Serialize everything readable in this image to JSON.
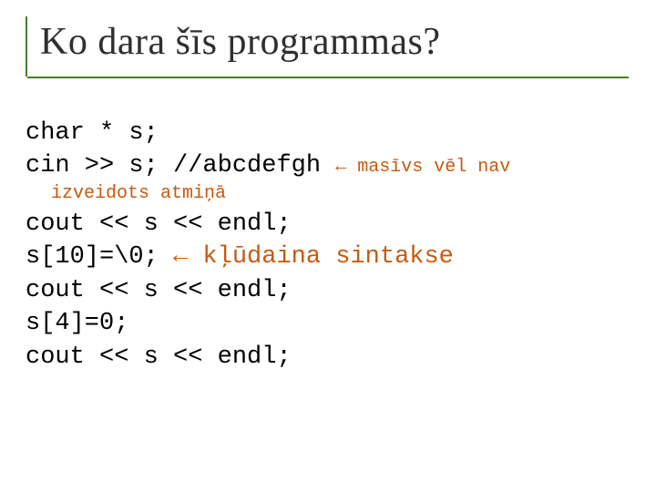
{
  "title": "Ko dara šīs programmas?",
  "code": {
    "l1": "char * s;",
    "l2a": "cin >> s; //abcdefgh ",
    "l2b_arrow": "←",
    "l2b_rest": " masīvs vēl nav",
    "l2c": "izveidots atmiņā",
    "l3": "cout << s << endl;",
    "l4a": "s[10]=\\0; ",
    "l4b_arrow": "←",
    "l4b_rest": " kļūdaina sintakse",
    "l5": "cout << s << endl;",
    "l6": "s[4]=0;",
    "l7": "cout << s << endl;"
  }
}
